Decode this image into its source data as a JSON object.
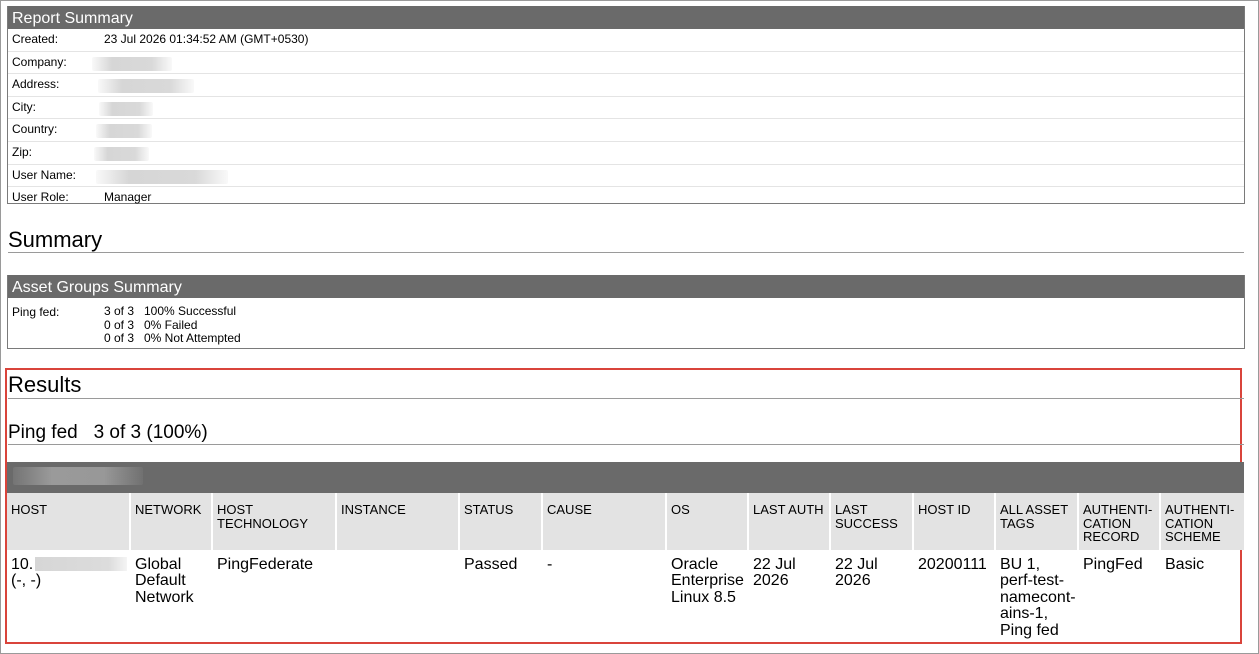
{
  "report_summary": {
    "title": "Report Summary",
    "rows": [
      {
        "label": "Created:",
        "value": "23 Jul 2026 01:34:52 AM (GMT+0530)"
      },
      {
        "label": "Company:",
        "value": ""
      },
      {
        "label": "Address:",
        "value": ""
      },
      {
        "label": "City:",
        "value": ""
      },
      {
        "label": "Country:",
        "value": ""
      },
      {
        "label": "Zip:",
        "value": ""
      },
      {
        "label": "User Name:",
        "value": ""
      },
      {
        "label": "User Role:",
        "value": "Manager"
      }
    ]
  },
  "summary": {
    "heading": "Summary",
    "asset_groups": {
      "title": "Asset Groups Summary",
      "group_label": "Ping fed:",
      "lines": [
        {
          "count": "3 of 3",
          "text": "100% Successful"
        },
        {
          "count": "0 of 3",
          "text": "0% Failed"
        },
        {
          "count": "0 of 3",
          "text": "0% Not Attempted"
        }
      ]
    }
  },
  "results": {
    "heading": "Results",
    "group_name": "Ping fed",
    "group_stats": "3 of 3 (100%)",
    "columns": [
      "HOST",
      "NETWORK",
      "HOST TECHNOLOGY",
      "INSTANCE",
      "STATUS",
      "CAUSE",
      "OS",
      "LAST AUTH",
      "LAST SUCCESS",
      "HOST ID",
      "ALL ASSET TAGS",
      "AUTHENTI-CATION RECORD",
      "AUTHENTI-CATION SCHEME"
    ],
    "row": {
      "host_prefix": "10.",
      "host_suffix": "(-, -)",
      "network": "Global Default Network",
      "host_technology": "PingFederate",
      "instance": "",
      "status": "Passed",
      "cause": "-",
      "os": "Oracle Enterprise Linux 8.5",
      "last_auth": "22 Jul 2026",
      "last_success": "22 Jul 2026",
      "host_id": "20200111",
      "asset_tags": "BU 1, perf-test-namecont-ains-1, Ping fed",
      "auth_record": "PingFed",
      "auth_scheme": "Basic"
    }
  },
  "colors": {
    "header_bg": "#6a6a6a",
    "column_header_bg": "#e3e3e3",
    "highlight_border": "#d9443b"
  }
}
